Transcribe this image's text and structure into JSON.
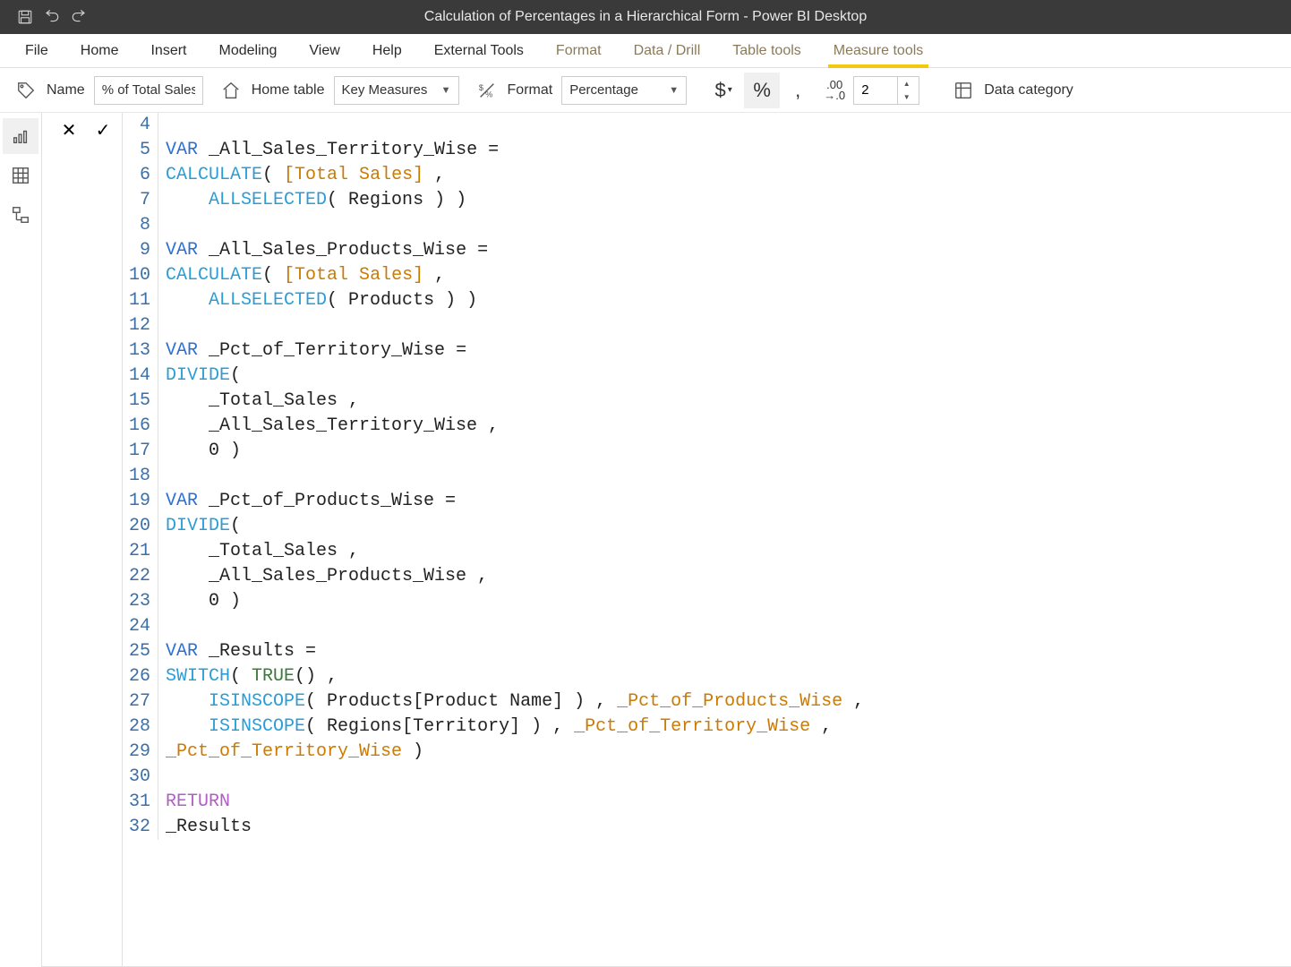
{
  "titlebar": {
    "title": "Calculation of Percentages in a Hierarchical Form - Power BI Desktop"
  },
  "ribbon_tabs": [
    "File",
    "Home",
    "Insert",
    "Modeling",
    "View",
    "Help",
    "External Tools",
    "Format",
    "Data / Drill",
    "Table tools",
    "Measure tools"
  ],
  "ribbon_active_index": 10,
  "ribbon_faded_from": 7,
  "measure": {
    "name_label": "Name",
    "name_value": "% of Total Sales...",
    "home_table_label": "Home table",
    "home_table_value": "Key Measures",
    "format_label": "Format",
    "format_value": "Percentage",
    "decimals_value": "2",
    "data_category_label": "Data category"
  },
  "code_lines": [
    {
      "n": 4,
      "tokens": []
    },
    {
      "n": 5,
      "tokens": [
        {
          "t": "VAR",
          "c": "kw-var"
        },
        {
          "t": " _All_Sales_Territory_Wise ="
        }
      ]
    },
    {
      "n": 6,
      "tokens": [
        {
          "t": "CALCULATE",
          "c": "kw-fn"
        },
        {
          "t": "( "
        },
        {
          "t": "[Total Sales]",
          "c": "kw-measure"
        },
        {
          "t": " ,"
        }
      ]
    },
    {
      "n": 7,
      "tokens": [
        {
          "t": "    "
        },
        {
          "t": "ALLSELECTED",
          "c": "kw-fn"
        },
        {
          "t": "( Regions ) )"
        }
      ]
    },
    {
      "n": 8,
      "tokens": []
    },
    {
      "n": 9,
      "tokens": [
        {
          "t": "VAR",
          "c": "kw-var"
        },
        {
          "t": " _All_Sales_Products_Wise ="
        }
      ]
    },
    {
      "n": 10,
      "tokens": [
        {
          "t": "CALCULATE",
          "c": "kw-fn"
        },
        {
          "t": "( "
        },
        {
          "t": "[Total Sales]",
          "c": "kw-measure"
        },
        {
          "t": " ,"
        }
      ]
    },
    {
      "n": 11,
      "tokens": [
        {
          "t": "    "
        },
        {
          "t": "ALLSELECTED",
          "c": "kw-fn"
        },
        {
          "t": "( Products ) )"
        }
      ]
    },
    {
      "n": 12,
      "tokens": []
    },
    {
      "n": 13,
      "tokens": [
        {
          "t": "VAR",
          "c": "kw-var"
        },
        {
          "t": " _Pct_of_Territory_Wise ="
        }
      ]
    },
    {
      "n": 14,
      "tokens": [
        {
          "t": "DIVIDE",
          "c": "kw-fn"
        },
        {
          "t": "("
        }
      ]
    },
    {
      "n": 15,
      "tokens": [
        {
          "t": "    _Total_Sales ,"
        }
      ]
    },
    {
      "n": 16,
      "tokens": [
        {
          "t": "    _All_Sales_Territory_Wise ,"
        }
      ]
    },
    {
      "n": 17,
      "tokens": [
        {
          "t": "    0 )"
        }
      ]
    },
    {
      "n": 18,
      "tokens": []
    },
    {
      "n": 19,
      "tokens": [
        {
          "t": "VAR",
          "c": "kw-var"
        },
        {
          "t": " _Pct_of_Products_Wise ="
        }
      ]
    },
    {
      "n": 20,
      "tokens": [
        {
          "t": "DIVIDE",
          "c": "kw-fn"
        },
        {
          "t": "("
        }
      ]
    },
    {
      "n": 21,
      "tokens": [
        {
          "t": "    _Total_Sales ,"
        }
      ]
    },
    {
      "n": 22,
      "tokens": [
        {
          "t": "    _All_Sales_Products_Wise ,"
        }
      ]
    },
    {
      "n": 23,
      "tokens": [
        {
          "t": "    0 )"
        }
      ]
    },
    {
      "n": 24,
      "tokens": []
    },
    {
      "n": 25,
      "tokens": [
        {
          "t": "VAR",
          "c": "kw-var"
        },
        {
          "t": " _Results ="
        }
      ]
    },
    {
      "n": 26,
      "tokens": [
        {
          "t": "SWITCH",
          "c": "kw-fn"
        },
        {
          "t": "( "
        },
        {
          "t": "TRUE",
          "c": "kw-const"
        },
        {
          "t": "() ,"
        }
      ]
    },
    {
      "n": 27,
      "tokens": [
        {
          "t": "    "
        },
        {
          "t": "ISINSCOPE",
          "c": "kw-fn"
        },
        {
          "t": "( Products[Product Name] ) , "
        },
        {
          "t": "_Pct_of_Products_Wise",
          "c": "kw-measure"
        },
        {
          "t": " ,"
        }
      ]
    },
    {
      "n": 28,
      "tokens": [
        {
          "t": "    "
        },
        {
          "t": "ISINSCOPE",
          "c": "kw-fn"
        },
        {
          "t": "( Regions[Territory] ) , "
        },
        {
          "t": "_Pct_of_Territory_Wise",
          "c": "kw-measure"
        },
        {
          "t": " ,"
        }
      ]
    },
    {
      "n": 29,
      "tokens": [
        {
          "t": "_Pct_of_Territory_Wise",
          "c": "kw-measure"
        },
        {
          "t": " )"
        }
      ]
    },
    {
      "n": 30,
      "tokens": []
    },
    {
      "n": 31,
      "tokens": [
        {
          "t": "RETURN",
          "c": "kw-keyword"
        }
      ]
    },
    {
      "n": 32,
      "tokens": [
        {
          "t": "_Results"
        }
      ]
    }
  ]
}
